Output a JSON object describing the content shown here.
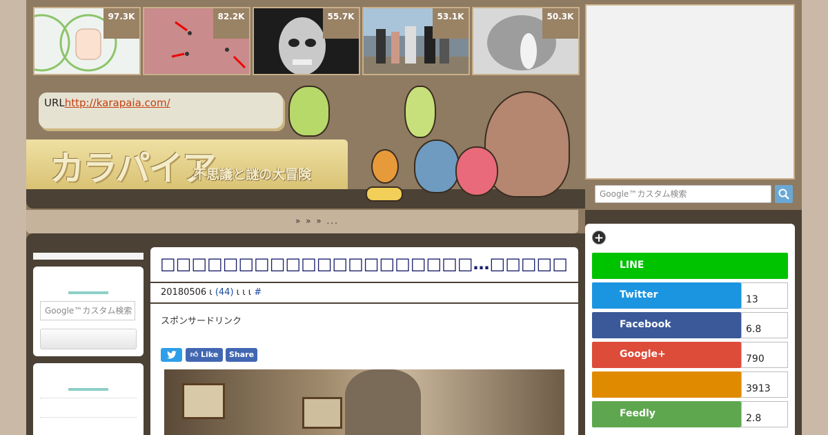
{
  "thumbnails": [
    {
      "count": "97.3K"
    },
    {
      "count": "82.2K"
    },
    {
      "count": "55.7K"
    },
    {
      "count": "53.1K"
    },
    {
      "count": "50.3K"
    }
  ],
  "header": {
    "url_label": "URL",
    "url_link": "http://karapaia.com/",
    "logo_text": "カラパイア",
    "tagline": "不思議と謎の大冒険"
  },
  "breadcrumb": "»  »       » ...",
  "left_sidebar": {
    "search_placeholder": "Google™カスタム検索"
  },
  "article": {
    "title": "□□□□□□□□□□□□□□□□□□□□…□□□□□□□□□□□□□□□□□□□□□□□□□",
    "meta_date": "20180506 ι",
    "meta_comments": "(44)",
    "meta_mid": " ι  ι        ι",
    "meta_tag": "#",
    "sponsored": "スポンサードリンク",
    "share": {
      "twitter": "",
      "like": "Like",
      "share": "Share"
    }
  },
  "right_sidebar": {
    "search_placeholder": "Google™カスタム検索",
    "social": [
      {
        "name": "LINE",
        "count": "",
        "color": "#00c300"
      },
      {
        "name": "Twitter",
        "count": "13",
        "color": "#1b95e0"
      },
      {
        "name": "Facebook",
        "count": "6.8",
        "color": "#3b5998"
      },
      {
        "name": "Google+",
        "count": "790",
        "color": "#dd4b39"
      },
      {
        "name": "",
        "count": "3913",
        "color": "#e08a00"
      },
      {
        "name": "Feedly",
        "count": "2.8",
        "color": "#5ea74f"
      }
    ]
  }
}
